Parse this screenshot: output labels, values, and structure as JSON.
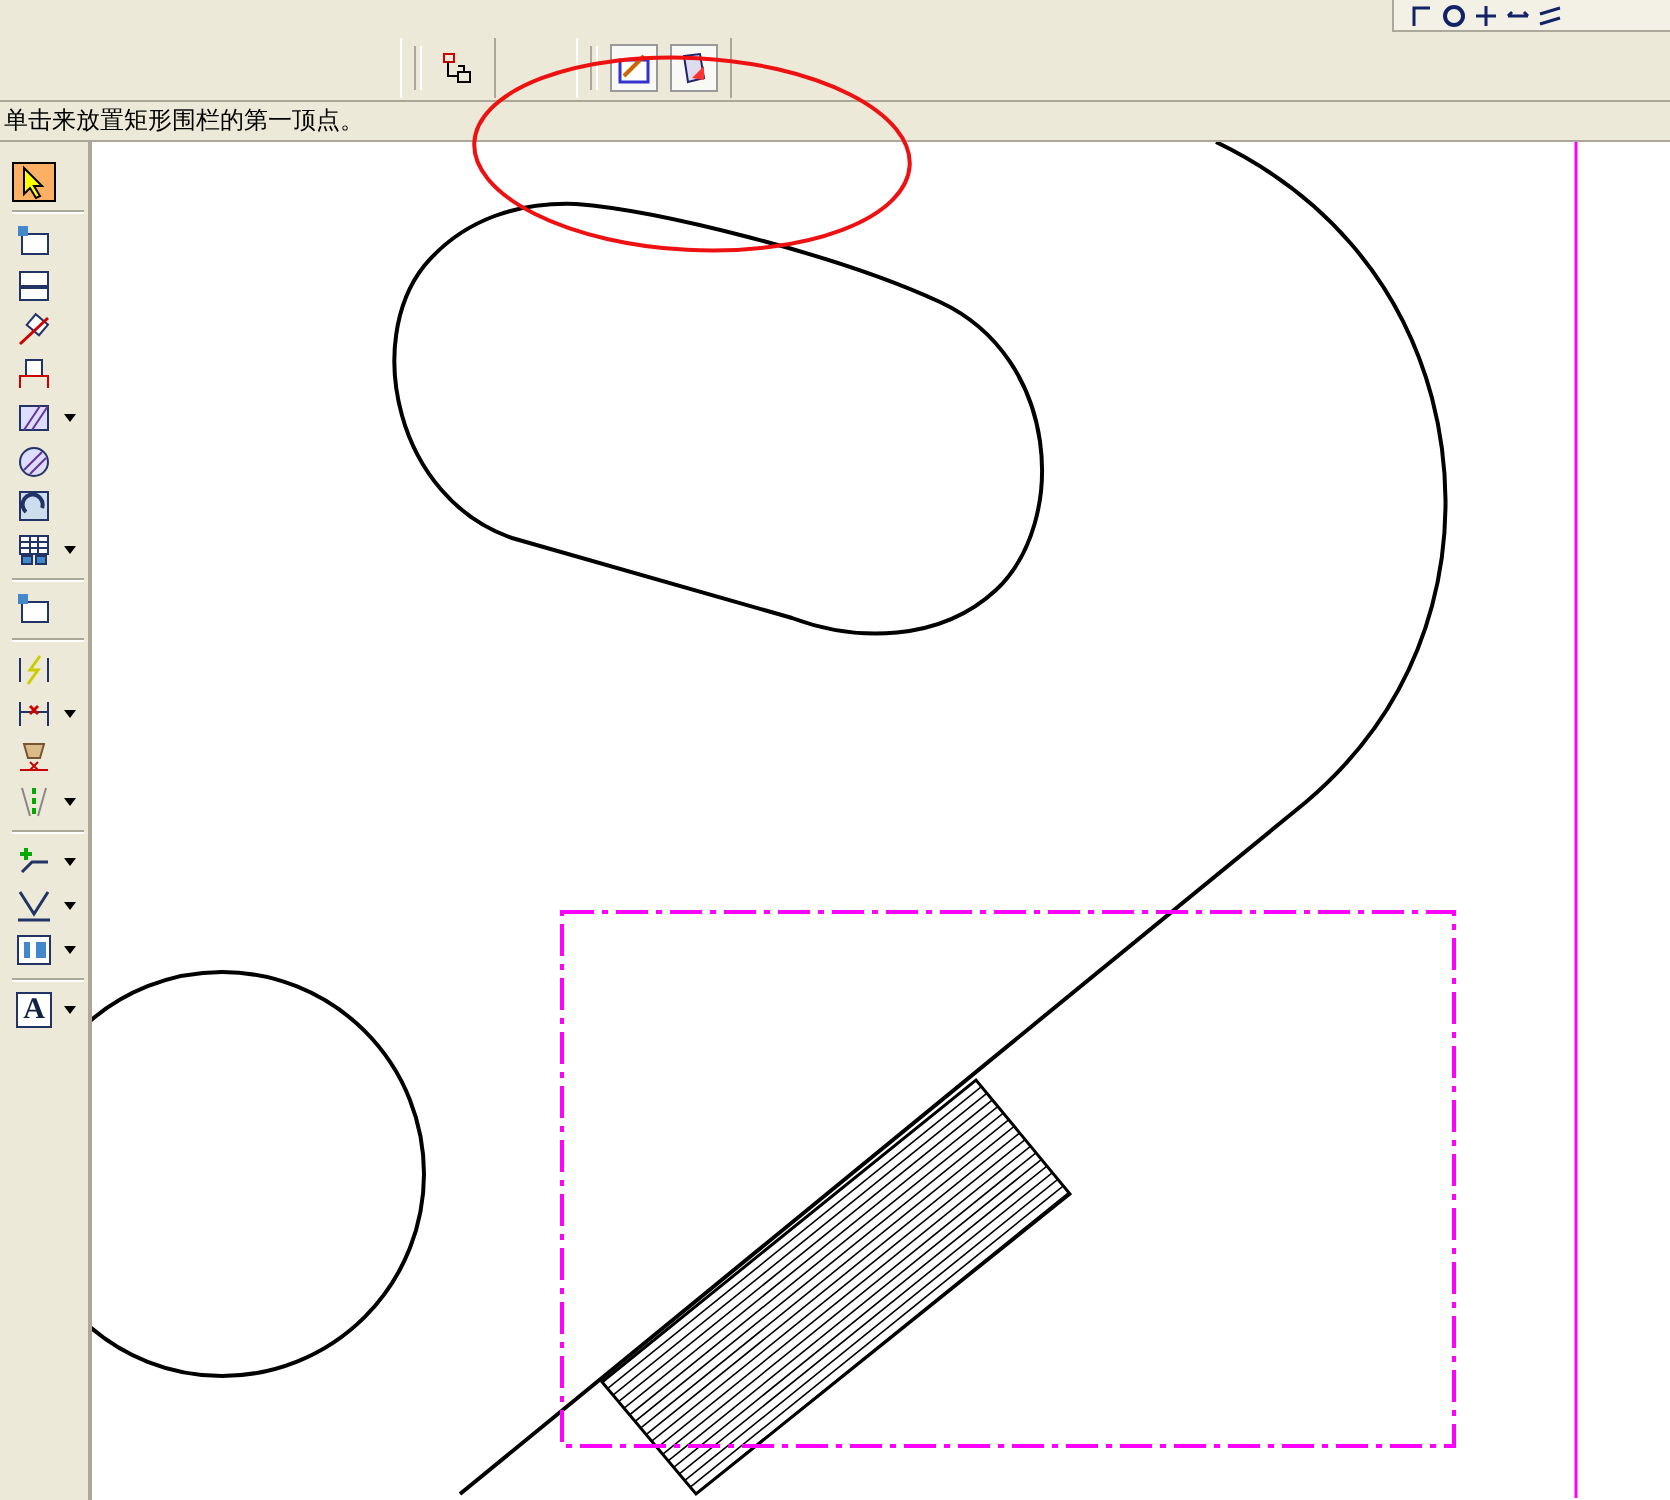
{
  "top_toolbar": {
    "groups": [
      {
        "buttons": [
          {
            "kind": "tree"
          }
        ]
      },
      {
        "buttons": [
          {
            "kind": "sketch"
          },
          {
            "kind": "sketch-3d"
          }
        ]
      }
    ]
  },
  "top_right_toolbar": {
    "buttons": [
      {
        "kind": "corner"
      },
      {
        "kind": "ring"
      },
      {
        "kind": "cross"
      },
      {
        "kind": "arrows"
      },
      {
        "kind": "slash"
      }
    ]
  },
  "prompt": "单击来放置矩形围栏的第一顶点。",
  "left_toolbar": {
    "items": [
      {
        "kind": "select",
        "selected": true,
        "dropdown": false
      },
      {
        "kind": "separator"
      },
      {
        "kind": "view",
        "selected": false,
        "dropdown": false
      },
      {
        "kind": "section",
        "selected": false,
        "dropdown": false
      },
      {
        "kind": "break",
        "selected": false,
        "dropdown": false
      },
      {
        "kind": "detail",
        "selected": false,
        "dropdown": false
      },
      {
        "kind": "hatch",
        "selected": false,
        "dropdown": true
      },
      {
        "kind": "round-hatch",
        "selected": false,
        "dropdown": false
      },
      {
        "kind": "rotate",
        "selected": false,
        "dropdown": false
      },
      {
        "kind": "table",
        "selected": false,
        "dropdown": true
      },
      {
        "kind": "separator"
      },
      {
        "kind": "view",
        "selected": false,
        "dropdown": false
      },
      {
        "kind": "separator"
      },
      {
        "kind": "dim-bolt",
        "selected": false,
        "dropdown": false
      },
      {
        "kind": "dim-x",
        "selected": false,
        "dropdown": true
      },
      {
        "kind": "dim-hand",
        "selected": false,
        "dropdown": false
      },
      {
        "kind": "centerline",
        "selected": false,
        "dropdown": true
      },
      {
        "kind": "separator"
      },
      {
        "kind": "leader",
        "selected": false,
        "dropdown": true
      },
      {
        "kind": "weld",
        "selected": false,
        "dropdown": true
      },
      {
        "kind": "frame",
        "selected": false,
        "dropdown": true
      },
      {
        "kind": "separator"
      },
      {
        "kind": "text",
        "label": "A",
        "selected": false,
        "dropdown": true
      }
    ]
  }
}
